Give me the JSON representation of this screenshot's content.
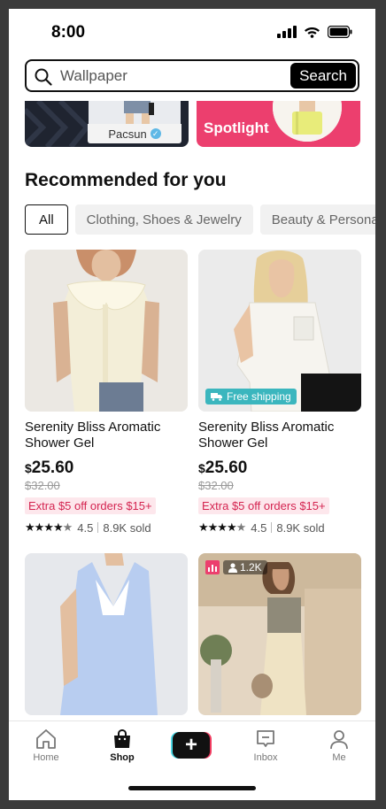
{
  "status_bar": {
    "time": "8:00"
  },
  "search": {
    "placeholder": "Wallpaper",
    "button_label": "Search"
  },
  "banners": {
    "left_brand": "Pacsun",
    "right_label": "Spotlight"
  },
  "section_title": "Recommended for you",
  "categories": [
    "All",
    "Clothing, Shoes & Jewelry",
    "Beauty & Personal Care"
  ],
  "products": [
    {
      "title": "Serenity Bliss Aromatic Shower Gel",
      "currency": "$",
      "price": "25.60",
      "original_price": "$32.00",
      "promo": "Extra $5 off orders $15+",
      "rating": "4.5",
      "sold": "8.9K sold"
    },
    {
      "title": "Serenity Bliss Aromatic Shower Gel",
      "currency": "$",
      "price": "25.60",
      "original_price": "$32.00",
      "promo": "Extra $5 off orders $15+",
      "rating": "4.5",
      "sold": "8.9K sold",
      "badge": "Free shipping"
    }
  ],
  "live": {
    "viewers": "1.2K"
  },
  "nav": {
    "home": "Home",
    "shop": "Shop",
    "inbox": "Inbox",
    "me": "Me"
  },
  "colors": {
    "accent_pink": "#ec3f6e",
    "shipping_teal": "#3bb6be",
    "promo_text": "#d42450"
  }
}
